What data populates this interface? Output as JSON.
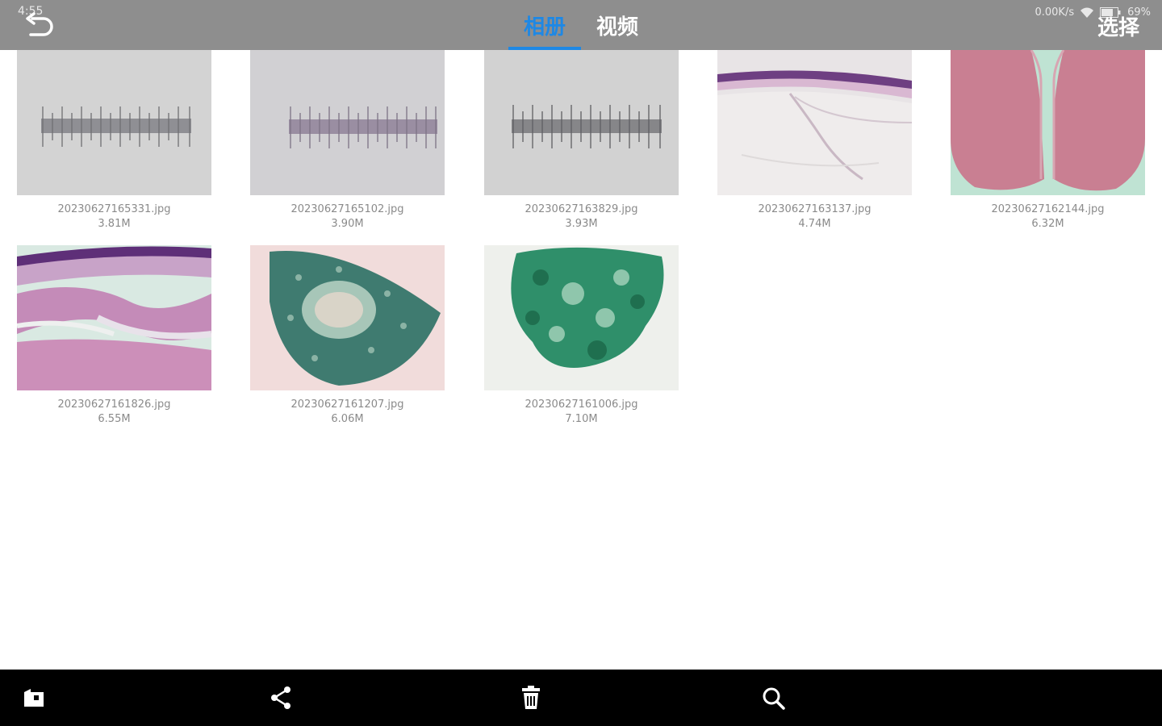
{
  "status_bar": {
    "time": "4:55",
    "speed": "0.00K/s",
    "battery": "69%"
  },
  "header": {
    "tabs": [
      {
        "label": "相册",
        "active": true
      },
      {
        "label": "视频",
        "active": false
      }
    ],
    "select_label": "选择",
    "accent_color": "#1e88e5"
  },
  "gallery": {
    "items": [
      {
        "filename": "20230627165331.jpg",
        "size": "3.81M",
        "kind": "ruler-grey"
      },
      {
        "filename": "20230627165102.jpg",
        "size": "3.90M",
        "kind": "ruler-purple"
      },
      {
        "filename": "20230627163829.jpg",
        "size": "3.93M",
        "kind": "ruler-dark"
      },
      {
        "filename": "20230627163137.jpg",
        "size": "4.74M",
        "kind": "tissue-layer"
      },
      {
        "filename": "20230627162144.jpg",
        "size": "6.32M",
        "kind": "tissue-lobes"
      },
      {
        "filename": "20230627161826.jpg",
        "size": "6.55M",
        "kind": "tissue-bands"
      },
      {
        "filename": "20230627161207.jpg",
        "size": "6.06M",
        "kind": "tissue-section"
      },
      {
        "filename": "20230627161006.jpg",
        "size": "7.10M",
        "kind": "tissue-green"
      }
    ]
  },
  "bottom_bar": {
    "icons": [
      "folder-icon",
      "share-icon",
      "trash-icon",
      "search-icon"
    ]
  }
}
